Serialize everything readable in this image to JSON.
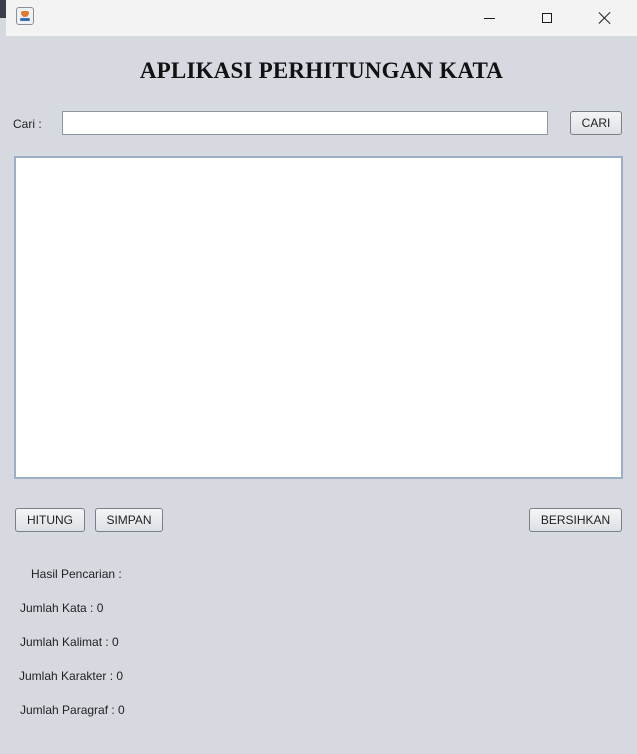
{
  "window": {
    "title": "",
    "controls": {
      "minimize": "minimize-icon",
      "maximize": "maximize-icon",
      "close": "close-icon"
    }
  },
  "app": {
    "heading": "APLIKASI PERHITUNGAN KATA"
  },
  "search": {
    "label": "Cari :",
    "value": "",
    "placeholder": "",
    "button_label": "CARI"
  },
  "editor": {
    "content": ""
  },
  "actions": {
    "count_label": "HITUNG",
    "save_label": "SIMPAN",
    "clear_label": "BERSIHKAN"
  },
  "results": {
    "search_result": "Hasil Pencarian :",
    "word_count": "Jumlah Kata : 0",
    "sentence_count": "Jumlah Kalimat : 0",
    "char_count": "Jumlah Karakter : 0",
    "paragraph_count": "Jumlah Paragraf : 0"
  },
  "colors": {
    "window_bg": "#d6d9e0",
    "titlebar_bg": "#f3f3f3",
    "textarea_border": "#9bb0c8"
  }
}
